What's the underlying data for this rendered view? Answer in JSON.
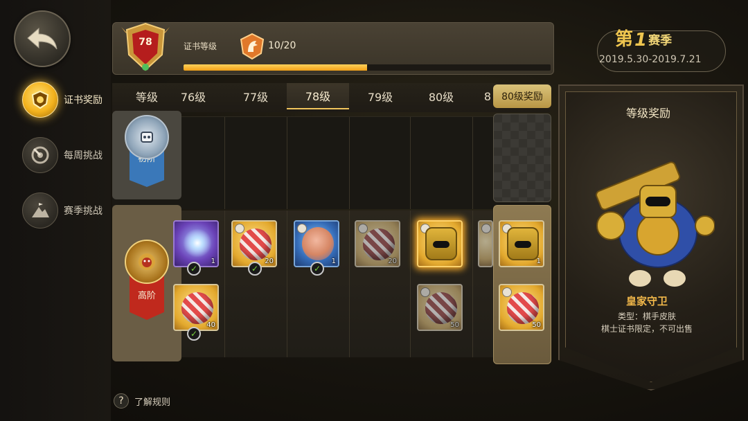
{
  "sidebar": {
    "items": [
      {
        "label": "证书奖励",
        "icon": "shield-badge-icon",
        "active": true
      },
      {
        "label": "每周挑战",
        "icon": "target-icon",
        "active": false
      },
      {
        "label": "赛季挑战",
        "icon": "mountain-flag-icon",
        "active": false
      }
    ],
    "help_label": "了解规则"
  },
  "header": {
    "level": "78",
    "cert_label": "证书等级",
    "xp_text": "10/20",
    "xp_progress": 0.5,
    "season": {
      "prefix": "第",
      "number": "1",
      "suffix": "赛季",
      "dates": "2019.5.30-2019.7.21"
    }
  },
  "grid": {
    "level_header": "等级",
    "columns": [
      "76级",
      "77级",
      "78级",
      "79级",
      "80级",
      "8"
    ],
    "active_column": "78级",
    "tiers": {
      "basic": "初阶",
      "advanced": "高阶"
    },
    "advanced_top_row": [
      {
        "type": "spark",
        "qty": "1",
        "claimed": true
      },
      {
        "type": "ball",
        "qty": "20",
        "claimed": true
      },
      {
        "type": "hero",
        "qty": "1",
        "claimed": true
      },
      {
        "type": "ball",
        "qty": "20",
        "claimed": false
      },
      {
        "type": "face",
        "qty": "",
        "claimed": false
      },
      {
        "type": "ball",
        "qty": "",
        "claimed": false
      }
    ],
    "advanced_bottom_row": [
      {
        "type": "ball",
        "qty": "40",
        "claimed": true
      },
      {
        "type": "ball",
        "qty": "50",
        "claimed": false
      }
    ]
  },
  "reward_column": {
    "title": "80级奖励",
    "cards": [
      {
        "type": "face",
        "qty": "1"
      },
      {
        "type": "ball",
        "qty": "50"
      }
    ]
  },
  "detail_panel": {
    "title": "等级奖励",
    "name": "皇家守卫",
    "type_line": "类型：棋手皮肤",
    "note": "棋士证书限定，不可出售"
  }
}
